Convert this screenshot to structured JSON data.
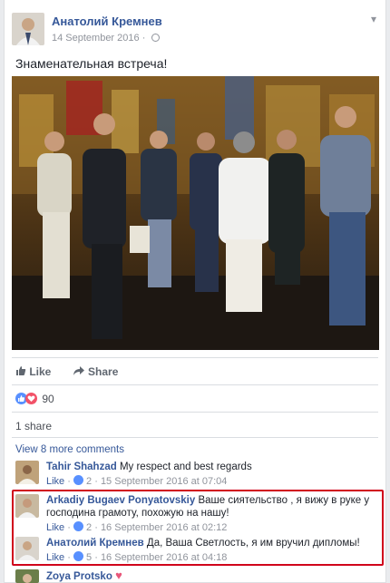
{
  "post": {
    "author": "Анатолий Кремнев",
    "date": "14 September 2016",
    "text": "Знаменательная встреча!"
  },
  "actions": {
    "like": "Like",
    "share": "Share"
  },
  "reactions": {
    "count": "90",
    "types": [
      "like-icon",
      "love-icon"
    ]
  },
  "shares": "1 share",
  "view_more": "View 8 more comments",
  "comments": [
    {
      "name": "Tahir Shahzad",
      "text": "My respect and best regards",
      "like_label": "Like",
      "likes": "2",
      "time": "15 September 2016 at 07:04"
    },
    {
      "name": "Arkadiy Bugaev Ponyatovskiy",
      "text": "Ваше сиятельство , я вижу в руке у господина грамоту, похожую на нашу!",
      "like_label": "Like",
      "likes": "2",
      "time": "16 September 2016 at 02:12"
    },
    {
      "name": "Анатолий Кремнев",
      "text": "Да, Ваша Светлость, я им вручил дипломы!",
      "like_label": "Like",
      "likes": "5",
      "time": "16 September 2016 at 04:18"
    },
    {
      "name": "Zoya Protsko"
    }
  ],
  "colors": {
    "link": "#365899",
    "highlight": "#d0021b",
    "like": "#5890ff",
    "love": "#f25268"
  }
}
